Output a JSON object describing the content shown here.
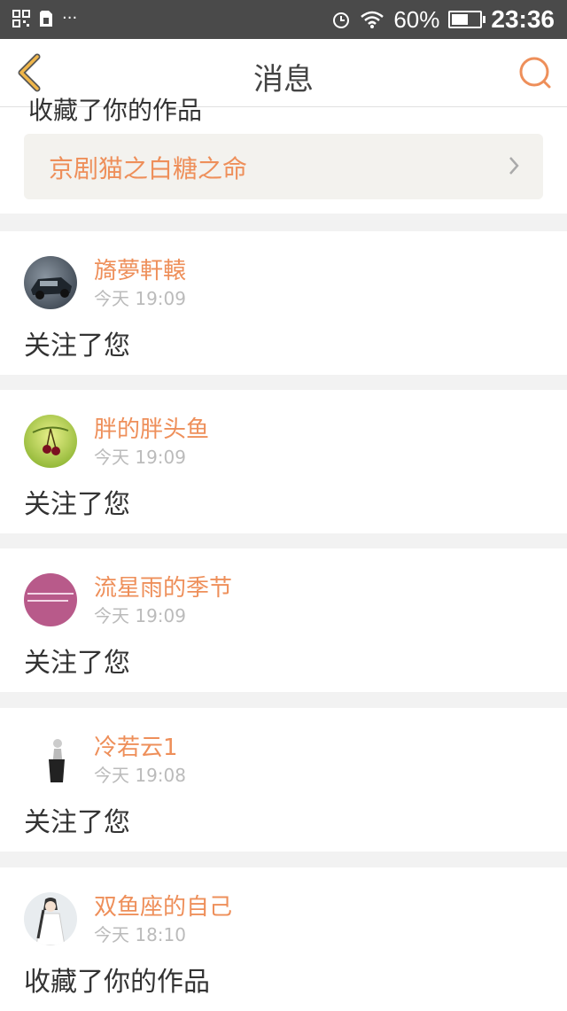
{
  "status_bar": {
    "left_icons": [
      "qr-icon",
      "sim-icon",
      "more-notifications"
    ],
    "more_label": "···",
    "battery_percent": "60%",
    "battery_level": 0.6,
    "time": "23:36"
  },
  "nav": {
    "title": "消息"
  },
  "partial": {
    "text": "收藏了你的作品",
    "work_title": "京剧猫之白糖之命"
  },
  "messages": [
    {
      "name": "旖夢軒轅",
      "time": "今天 19:09",
      "action": "关注了您",
      "avatar_color": "#3b4a5a"
    },
    {
      "name": "胖的胖头鱼",
      "time": "今天 19:09",
      "action": "关注了您",
      "avatar_color": "#9cc23a"
    },
    {
      "name": "流星雨的季节",
      "time": "今天 19:09",
      "action": "关注了您",
      "avatar_color": "#b85a8a"
    },
    {
      "name": "冷若云1",
      "time": "今天 19:08",
      "action": "关注了您",
      "avatar_color": "#ffffff"
    },
    {
      "name": "双鱼座的自己",
      "time": "今天 18:10",
      "action": "收藏了你的作品",
      "avatar_color": "#e8ecef"
    }
  ],
  "colors": {
    "accent": "#ee8f5a",
    "status_bar": "#4a4a4a",
    "background": "#f2f2f2",
    "back_arrow": "#f0b64a"
  }
}
